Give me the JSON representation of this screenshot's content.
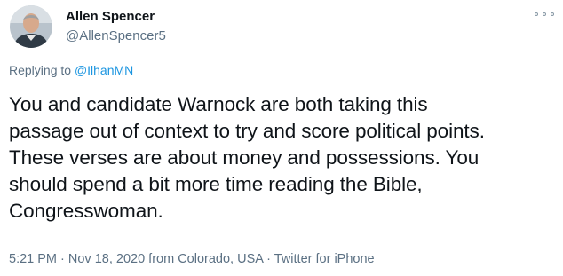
{
  "tweet": {
    "author": {
      "name": "Allen Spencer",
      "handle": "@AllenSpencer5"
    },
    "reply": {
      "prefix": "Replying to ",
      "to": "@IlhanMN"
    },
    "body_lines": [
      "You and candidate Warnock are both taking this",
      "passage out of context to try and score political points.",
      "These verses are about money and possessions. You",
      "should spend a bit more time reading the Bible,",
      "Congresswoman."
    ],
    "meta": {
      "time": "5:21 PM",
      "sep1": " · ",
      "date": "Nov 18, 2020",
      "location": " from Colorado, USA",
      "sep2": " · ",
      "source": "Twitter for iPhone"
    },
    "icons": {
      "more": "more-options-icon",
      "avatar": "profile-photo"
    }
  }
}
